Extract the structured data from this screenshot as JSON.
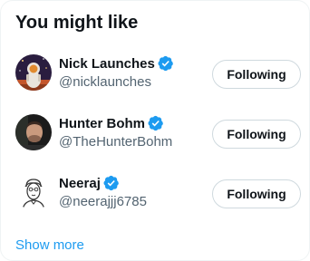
{
  "panel": {
    "title": "You might like",
    "show_more_label": "Show more"
  },
  "users": [
    {
      "display_name": "Nick Launches",
      "handle": "@nicklaunches",
      "verified": true,
      "button_label": "Following",
      "avatar_icon": "astronaut-avatar"
    },
    {
      "display_name": "Hunter Bohm",
      "handle": "@TheHunterBohm",
      "verified": true,
      "button_label": "Following",
      "avatar_icon": "photo-portrait-avatar"
    },
    {
      "display_name": "Neeraj",
      "handle": "@neerajjj6785",
      "verified": true,
      "button_label": "Following",
      "avatar_icon": "sketch-portrait-avatar"
    }
  ],
  "colors": {
    "accent": "#1d9bf0",
    "text_primary": "#0f1419",
    "text_secondary": "#536471",
    "button_border": "#cfd9de"
  }
}
